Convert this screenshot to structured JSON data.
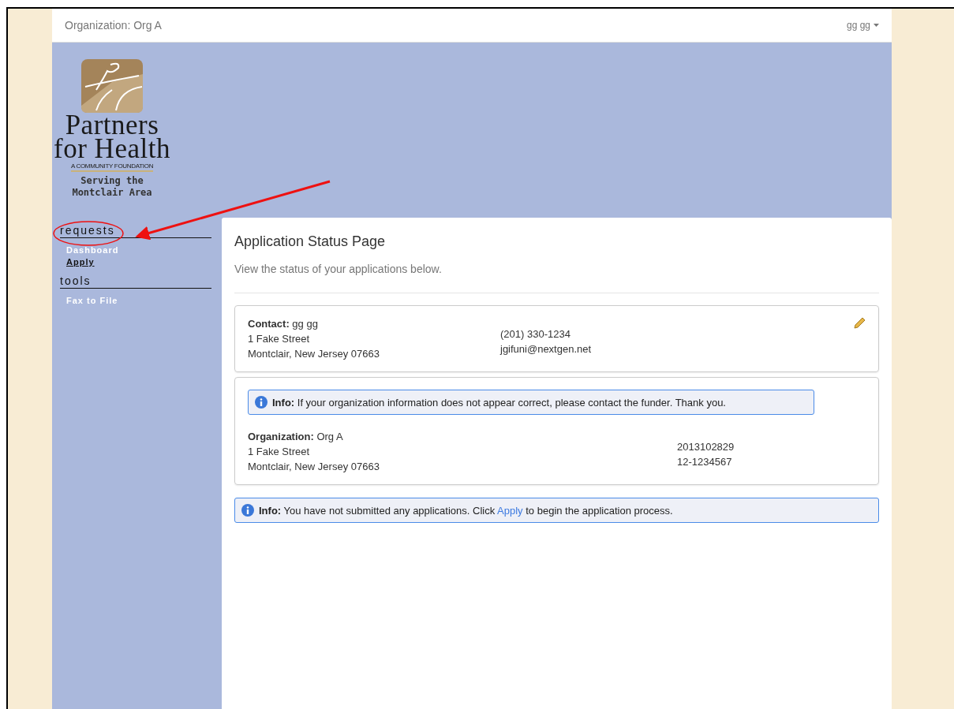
{
  "navbar": {
    "organization": "Organization: Org A",
    "user_menu": "gg gg"
  },
  "logo": {
    "line_1": "Partners",
    "line_2": "for Health",
    "tagline": "A COMMUNITY FOUNDATION",
    "serving_1": "Serving the",
    "serving_2": "Montclair Area"
  },
  "sidebar": {
    "sections": [
      {
        "title": "requests",
        "items": [
          {
            "label": "Dashboard",
            "selected": false
          },
          {
            "label": "Apply",
            "selected": true
          }
        ]
      },
      {
        "title": "tools",
        "items": [
          {
            "label": "Fax to File",
            "selected": false
          }
        ]
      }
    ]
  },
  "page": {
    "title": "Application Status Page",
    "subtitle": "View the status of your applications below."
  },
  "contact": {
    "label": "Contact:",
    "name": "gg gg",
    "address_1": "1 Fake Street",
    "address_2": "Montclair, New Jersey 07663",
    "phone": "(201) 330-1234",
    "email": "jgifuni@nextgen.net"
  },
  "organization": {
    "alert_label": "Info:",
    "alert_text": "If your organization information does not appear correct, please contact the funder. Thank you.",
    "label": "Organization:",
    "name": "Org A",
    "address_1": "1 Fake Street",
    "address_2": "Montclair, New Jersey 07663",
    "number_1": "2013102829",
    "number_2": "12-1234567"
  },
  "notice": {
    "label": "Info:",
    "before": "You have not submitted any applications. Click",
    "link": "Apply",
    "after": "to begin the application process."
  }
}
